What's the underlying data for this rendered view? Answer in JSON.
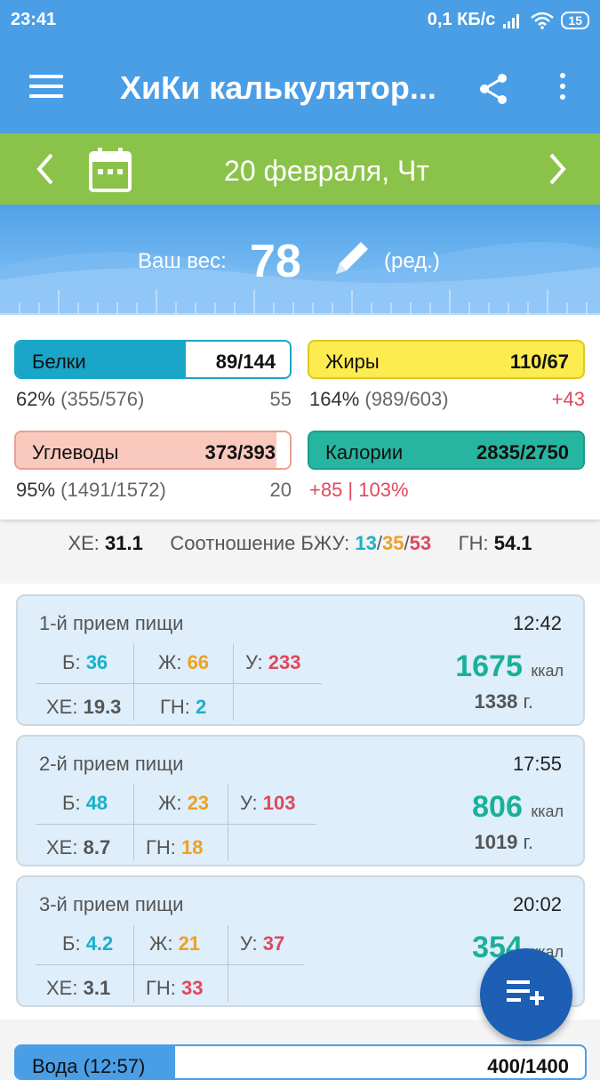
{
  "status": {
    "time": "23:41",
    "speed": "0,1 КБ/с",
    "battery": "15"
  },
  "appbar": {
    "title": "ХиКи калькулятор..."
  },
  "datebar": {
    "date": "20 февраля, Чт"
  },
  "weight": {
    "label": "Ваш вес:",
    "value": "78",
    "edit": "(ред.)"
  },
  "summary": {
    "protein": {
      "name": "Белки",
      "value": "89/144",
      "fill": 0.62,
      "pct": "62%",
      "detail": "(355/576)",
      "diff": "55",
      "color": "#1aa6c8"
    },
    "fat": {
      "name": "Жиры",
      "value": "110/67",
      "fill": 1.0,
      "pct": "164%",
      "detail": "(989/603)",
      "diff": "+43",
      "color": "#fcec4f"
    },
    "carbs": {
      "name": "Углеводы",
      "value": "373/393",
      "fill": 0.95,
      "pct": "95%",
      "detail": "(1491/1572)",
      "diff": "20",
      "color": "#f9c9bd"
    },
    "calories": {
      "name": "Калории",
      "value": "2835/2750",
      "fill": 1.0,
      "status": "+85 | 103%",
      "color": "#26b5a0"
    }
  },
  "ratio": {
    "xe_label": "ХЕ:",
    "xe": "31.1",
    "ratio_label": "Соотношение БЖУ:",
    "b": "13",
    "sep": "/",
    "f": "35",
    "c": "53",
    "gn_label": "ГН:",
    "gn": "54.1"
  },
  "meals": [
    {
      "title": "1-й прием пищи",
      "time": "12:42",
      "b_label": "Б:",
      "b": "36",
      "f_label": "Ж:",
      "f": "66",
      "c_label": "У:",
      "c": "233",
      "xe_label": "ХЕ:",
      "xe": "19.3",
      "gn_label": "ГН:",
      "gn": "2",
      "kcal": "1675",
      "kcal_unit": "ккал",
      "grams": "1338",
      "grams_unit": "г."
    },
    {
      "title": "2-й прием пищи",
      "time": "17:55",
      "b_label": "Б:",
      "b": "48",
      "f_label": "Ж:",
      "f": "23",
      "c_label": "У:",
      "c": "103",
      "xe_label": "ХЕ:",
      "xe": "8.7",
      "gn_label": "ГН:",
      "gn": "18",
      "kcal": "806",
      "kcal_unit": "ккал",
      "grams": "1019",
      "grams_unit": "г."
    },
    {
      "title": "3-й прием пищи",
      "time": "20:02",
      "b_label": "Б:",
      "b": "4.2",
      "f_label": "Ж:",
      "f": "21",
      "c_label": "У:",
      "c": "37",
      "xe_label": "ХЕ:",
      "xe": "3.1",
      "gn_label": "ГН:",
      "gn": "33",
      "kcal": "354",
      "kcal_unit": "ккал"
    }
  ],
  "water": {
    "name": "Вода (12:57)",
    "value": "400/1400",
    "fill": 0.28
  }
}
